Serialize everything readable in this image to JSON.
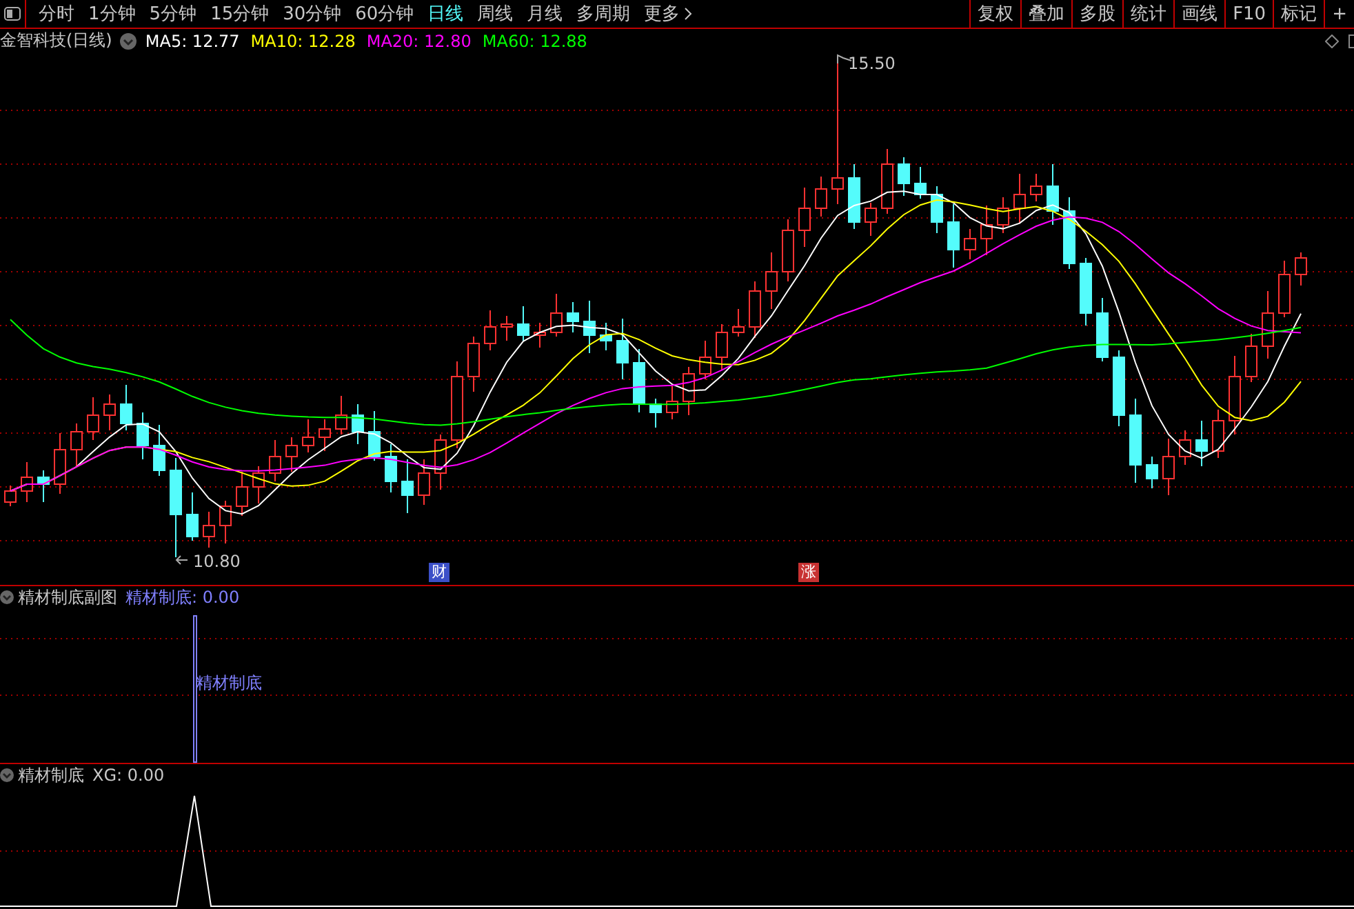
{
  "toolbar": {
    "periods": [
      {
        "label": "分时",
        "selected": false
      },
      {
        "label": "1分钟",
        "selected": false
      },
      {
        "label": "5分钟",
        "selected": false
      },
      {
        "label": "15分钟",
        "selected": false
      },
      {
        "label": "30分钟",
        "selected": false
      },
      {
        "label": "60分钟",
        "selected": false
      },
      {
        "label": "日线",
        "selected": true
      },
      {
        "label": "周线",
        "selected": false
      },
      {
        "label": "月线",
        "selected": false
      },
      {
        "label": "多周期",
        "selected": false
      },
      {
        "label": "更多",
        "selected": false
      }
    ],
    "buttons": [
      "复权",
      "叠加",
      "多股",
      "统计",
      "画线",
      "F10",
      "标记",
      "+"
    ]
  },
  "main_chart": {
    "stock_title": "金智科技(日线)",
    "indicators": [
      {
        "name": "MA5: 12.77",
        "color": "#ffffff"
      },
      {
        "name": "MA10: 12.28",
        "color": "#ffff00"
      },
      {
        "name": "MA20: 12.80",
        "color": "#ff00ff"
      },
      {
        "name": "MA60: 12.88",
        "color": "#00ff00"
      }
    ],
    "high_label": "15.50",
    "low_label": "10.80",
    "markers": [
      {
        "text": "财",
        "color": "#3c50c8"
      },
      {
        "text": "涨",
        "color": "#c83232"
      }
    ]
  },
  "sub_chart_1": {
    "title": "精材制底副图",
    "indicator": "精材制底: 0.00",
    "bar_label": "精材制底"
  },
  "sub_chart_2": {
    "title": "精材制底",
    "indicator": "XG: 0.00"
  }
}
